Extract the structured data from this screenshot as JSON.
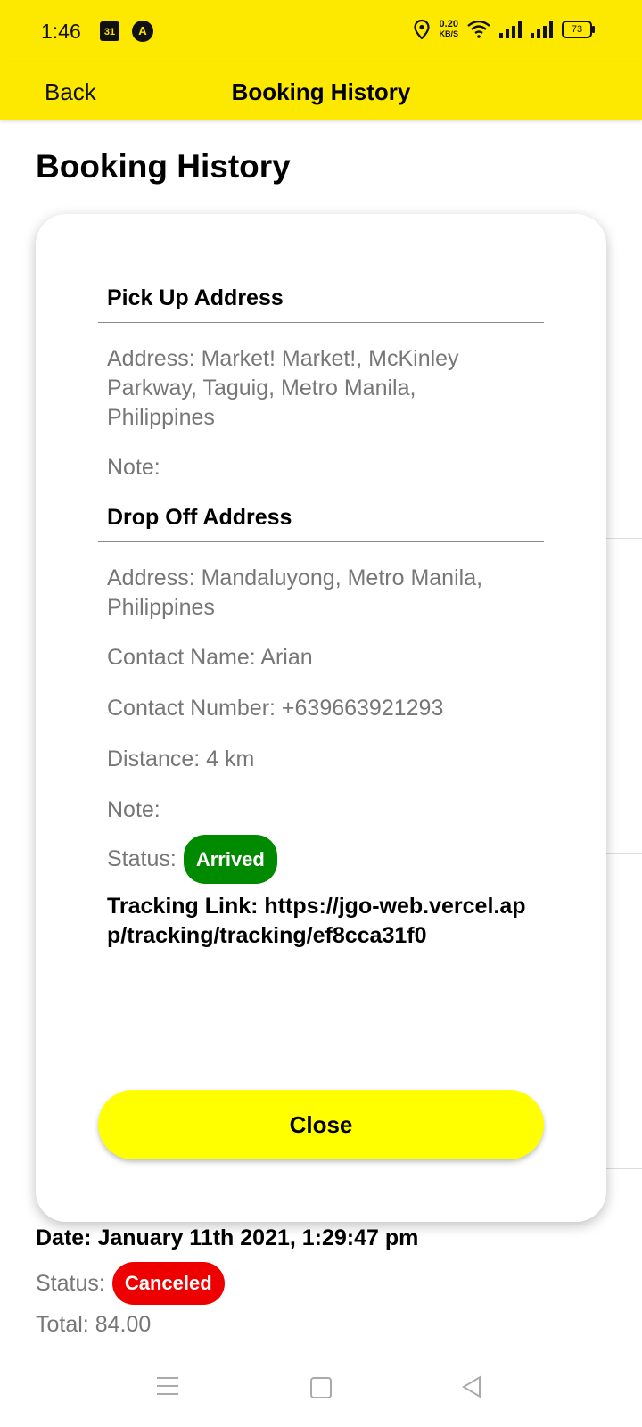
{
  "status_bar": {
    "time": "1:46",
    "calendar_badge": "31",
    "app_badge": "A",
    "speed_value": "0.20",
    "speed_unit": "KB/S",
    "battery": "73"
  },
  "app_bar": {
    "back_label": "Back",
    "title": "Booking History"
  },
  "page": {
    "title": "Booking History"
  },
  "background_item": {
    "date": "Date: January 11th 2021, 1:29:47 pm",
    "status_label": "Status:",
    "status_value": "Canceled",
    "total": "Total: 84.00"
  },
  "modal": {
    "pickup_heading": "Pick Up Address",
    "pickup_address": "Address: Market! Market!, McKinley Parkway, Taguig, Metro Manila, Philippines",
    "pickup_note": "Note:",
    "dropoff_heading": "Drop Off Address",
    "dropoff_address": "Address: Mandaluyong, Metro Manila, Philippines",
    "contact_name": "Contact Name: Arian",
    "contact_number": "Contact Number: +639663921293",
    "distance": "Distance: 4 km",
    "dropoff_note": "Note:",
    "status_label": "Status:",
    "status_value": "Arrived",
    "tracking_link": "Tracking Link: https://jgo-web.vercel.app/tracking/tracking/ef8cca31f0",
    "close_label": "Close"
  },
  "colors": {
    "header": "#fde800",
    "close_button": "#ffff00",
    "arrived": "#008a00",
    "canceled": "#ee0000"
  }
}
